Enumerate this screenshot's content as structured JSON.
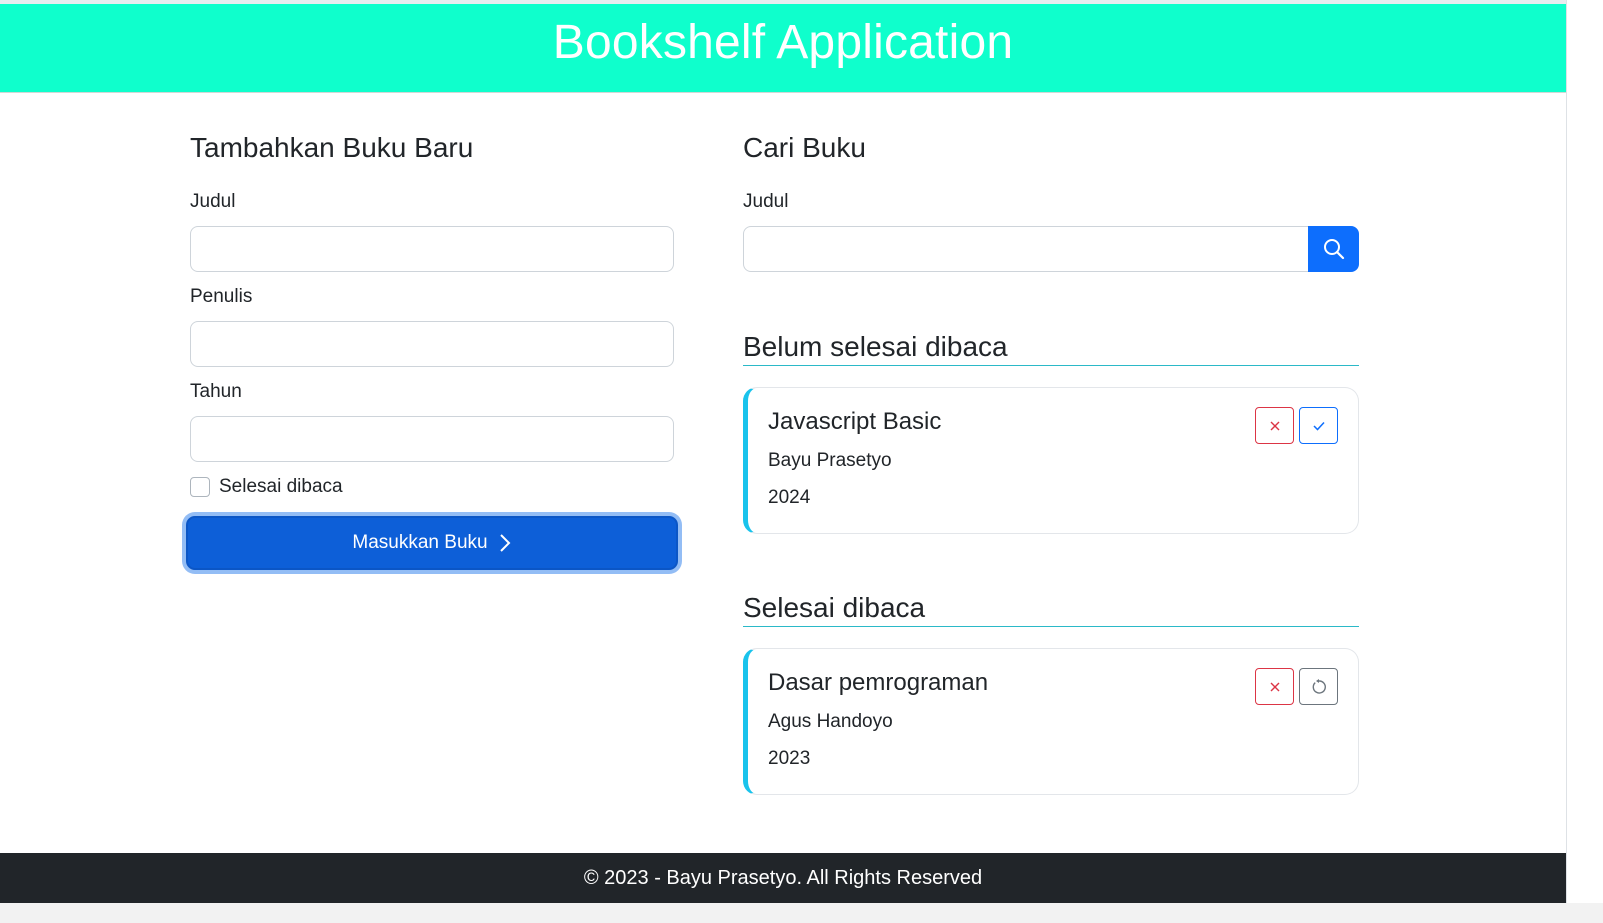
{
  "header": {
    "title": "Bookshelf Application"
  },
  "add_form": {
    "title": "Tambahkan Buku Baru",
    "title_label": "Judul",
    "title_value": "",
    "author_label": "Penulis",
    "author_value": "",
    "year_label": "Tahun",
    "year_value": "",
    "complete_label": "Selesai dibaca",
    "complete_checked": false,
    "submit_label": "Masukkan Buku"
  },
  "search": {
    "title": "Cari Buku",
    "label": "Judul",
    "value": ""
  },
  "unfinished": {
    "title": "Belum selesai dibaca",
    "books": [
      {
        "title": "Javascript Basic",
        "author": "Bayu Prasetyo",
        "year": "2024"
      }
    ]
  },
  "finished": {
    "title": "Selesai dibaca",
    "books": [
      {
        "title": "Dasar pemrograman",
        "author": "Agus Handoyo",
        "year": "2023"
      }
    ]
  },
  "footer": {
    "text": "© 2023 - Bayu Prasetyo. All Rights Reserved"
  },
  "colors": {
    "header_bg": "#0fffcc",
    "primary": "#0d6efd",
    "danger": "#dc3545",
    "accent_border": "#19c3ec",
    "footer_bg": "#212529"
  }
}
